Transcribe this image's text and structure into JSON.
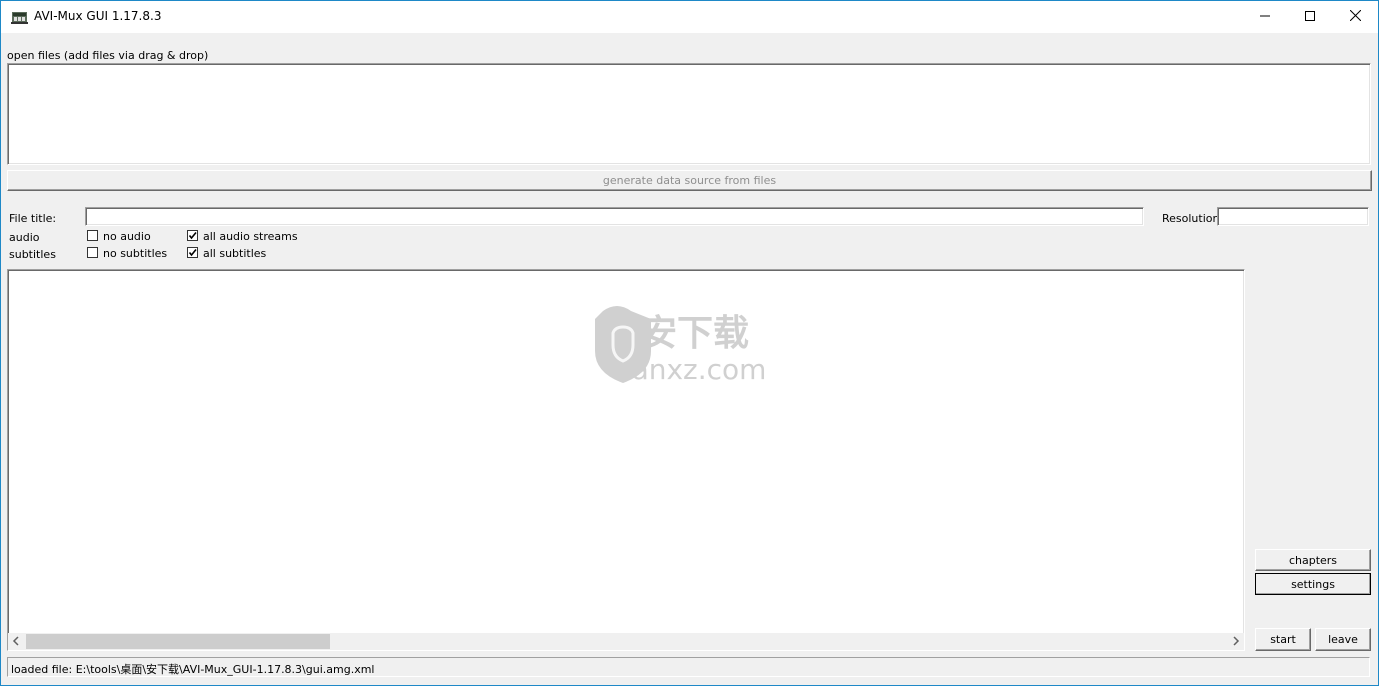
{
  "window": {
    "title": "AVI-Mux GUI 1.17.8.3",
    "controls": {
      "minimize": "minimize-icon",
      "maximize": "maximize-icon",
      "close": "close-icon"
    }
  },
  "open_files": {
    "label": "open files (add files via drag & drop)",
    "generate_button": "generate data source from files"
  },
  "file_title": {
    "label": "File title:",
    "value": ""
  },
  "resolution": {
    "label": "Resolution:",
    "value": ""
  },
  "audio": {
    "label": "audio",
    "no_audio": {
      "label": "no audio",
      "checked": false
    },
    "all_streams": {
      "label": "all audio streams",
      "checked": true
    }
  },
  "subtitles": {
    "label": "subtitles",
    "no_subtitles": {
      "label": "no subtitles",
      "checked": false
    },
    "all_subtitles": {
      "label": "all subtitles",
      "checked": true
    }
  },
  "buttons": {
    "chapters": "chapters",
    "settings": "settings",
    "start": "start",
    "leave": "leave"
  },
  "watermark": {
    "cn": "安下载",
    "en": "anxz.com"
  },
  "status": {
    "text": "loaded file: E:\\tools\\桌面\\安下载\\AVI-Mux_GUI-1.17.8.3\\gui.amg.xml"
  },
  "colors": {
    "accent_border": "#1e88c7",
    "window_bg": "#f0f0f0"
  }
}
